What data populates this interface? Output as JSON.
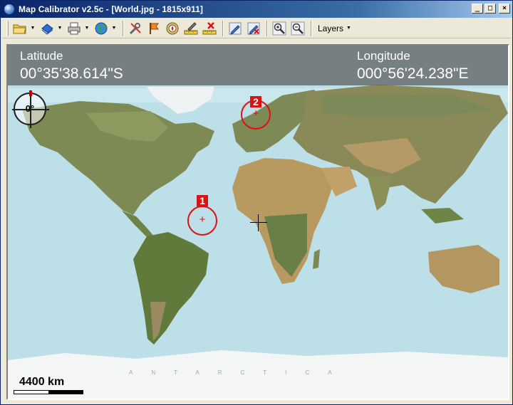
{
  "window": {
    "title": "Map Calibrator v2.5c - [World.jpg - 1815x911]",
    "buttons": [
      "_",
      "□",
      "×"
    ]
  },
  "toolbar": {
    "layers_label": "Layers",
    "icons": [
      "open-folder-icon",
      "save-disk-icon",
      "print-icon",
      "globe-icon",
      "tools-icon",
      "flag-icon",
      "compass-icon",
      "pencil-ruler-icon",
      "delete-points-icon",
      "edit-pen-icon",
      "erase-pen-icon",
      "zoom-in-icon",
      "zoom-out-icon"
    ]
  },
  "coords": {
    "latitude_label": "Latitude",
    "latitude_value": "00°35'38.614\"S",
    "longitude_label": "Longitude",
    "longitude_value": "000°56'24.238\"E"
  },
  "compass": {
    "heading": "0°"
  },
  "calibration_points": [
    {
      "id": "1"
    },
    {
      "id": "2"
    }
  ],
  "scale": {
    "label": "4400 km"
  },
  "map": {
    "antarctica_label": "ANTARCTICA"
  },
  "colors": {
    "ocean": "#bddfe8",
    "land": "#7c8a52",
    "desert": "#b89a62",
    "ice": "#f4f6f6",
    "marker": "#e01010"
  }
}
